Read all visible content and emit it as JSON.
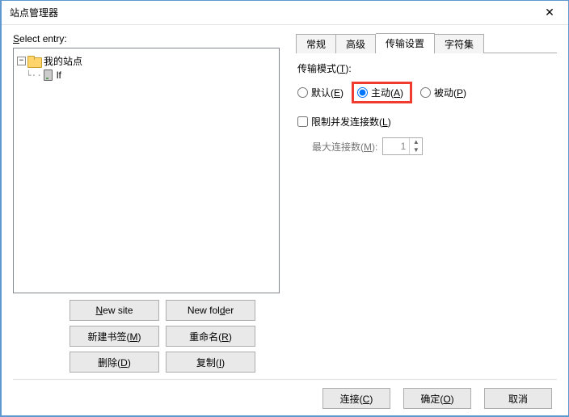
{
  "window": {
    "title": "站点管理器"
  },
  "left": {
    "select_entry_label_pre": "S",
    "select_entry_label_post": "elect entry:",
    "tree": {
      "root_label": "我的站点",
      "child_label": "lf"
    },
    "buttons": {
      "new_site_pre": "N",
      "new_site_post": "ew site",
      "new_folder": "New fol",
      "new_folder_u": "d",
      "new_folder_post": "er",
      "new_bookmark": "新建书签(",
      "new_bookmark_u": "M",
      "new_bookmark_post": ")",
      "rename": "重命名(",
      "rename_u": "R",
      "rename_post": ")",
      "delete": "删除(",
      "delete_u": "D",
      "delete_post": ")",
      "copy": "复制(",
      "copy_u": "I",
      "copy_post": ")"
    }
  },
  "tabs": {
    "general": "常规",
    "advanced": "高级",
    "transfer": "传输设置",
    "charset": "字符集"
  },
  "transfer": {
    "mode_label": "传输模式(",
    "mode_u": "T",
    "mode_post": "):",
    "default": "默认(",
    "default_u": "E",
    "default_post": ")",
    "active": "主动(",
    "active_u": "A",
    "active_post": ")",
    "passive": "被动(",
    "passive_u": "P",
    "passive_post": ")",
    "limit": "限制并发连接数(",
    "limit_u": "L",
    "limit_post": ")",
    "max_label": "最大连接数(",
    "max_u": "M",
    "max_post": "):",
    "max_value": "1"
  },
  "footer": {
    "connect": "连接(",
    "connect_u": "C",
    "connect_post": ")",
    "ok": "确定(",
    "ok_u": "O",
    "ok_post": ")",
    "cancel": "取消"
  }
}
